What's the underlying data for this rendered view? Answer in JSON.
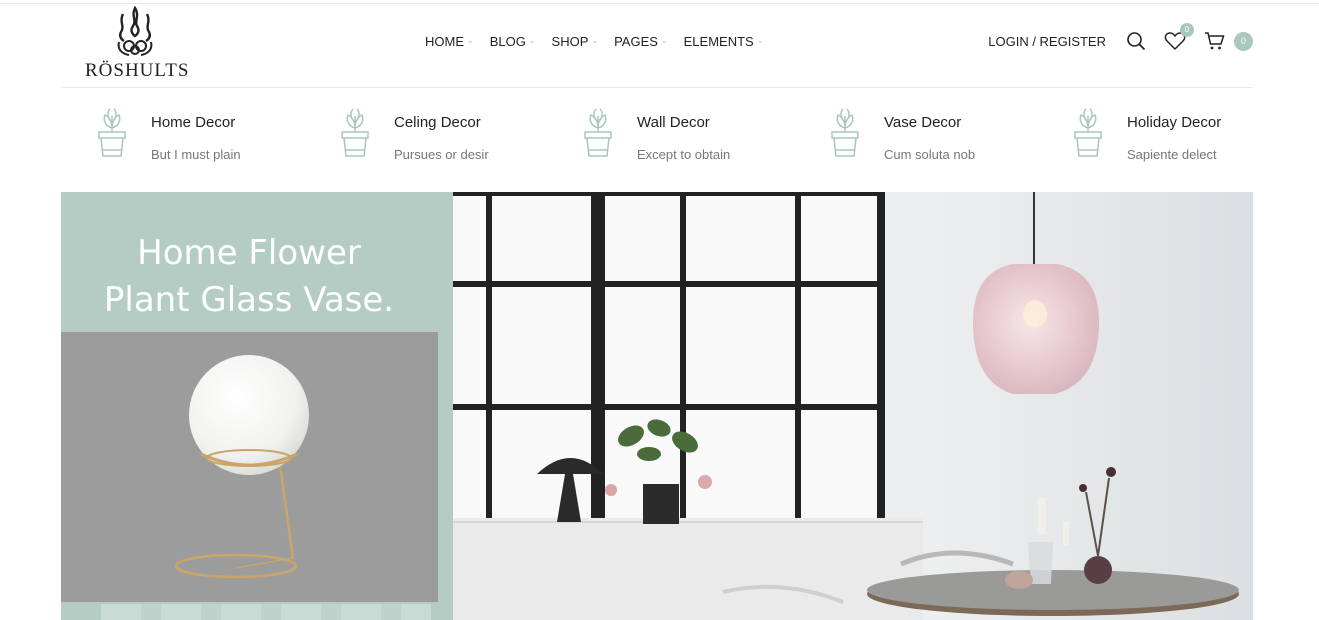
{
  "brand": {
    "name": "RÖSHULTS"
  },
  "nav": {
    "items": [
      {
        "label": "HOME",
        "has_dropdown": true
      },
      {
        "label": "BLOG",
        "has_dropdown": true
      },
      {
        "label": "SHOP",
        "has_dropdown": true
      },
      {
        "label": "PAGES",
        "has_dropdown": true
      },
      {
        "label": "ELEMENTS",
        "has_dropdown": true
      }
    ]
  },
  "header_tools": {
    "login_label": "LOGIN / REGISTER",
    "search_icon": "search-icon",
    "wishlist_icon": "heart-icon",
    "wishlist_count": "0",
    "cart_icon": "cart-icon",
    "cart_count": "0"
  },
  "categories": [
    {
      "title": "Home Decor",
      "subtitle": "But I must plain",
      "icon": "plant-pot-icon"
    },
    {
      "title": "Celing Decor",
      "subtitle": "Pursues or desir",
      "icon": "plant-pot-icon"
    },
    {
      "title": "Wall Decor",
      "subtitle": "Except to obtain",
      "icon": "plant-pot-icon"
    },
    {
      "title": "Vase Decor",
      "subtitle": "Cum soluta nob",
      "icon": "plant-pot-icon"
    },
    {
      "title": "Holiday Decor",
      "subtitle": "Sapiente delect",
      "icon": "plant-pot-icon"
    }
  ],
  "hero": {
    "title_line1": "Home Flower",
    "title_line2": "Plant Glass Vase."
  },
  "colors": {
    "accent": "#a9c8bd",
    "hero_panel": "#b5ccc4",
    "product_bg": "#9c9c9c"
  }
}
